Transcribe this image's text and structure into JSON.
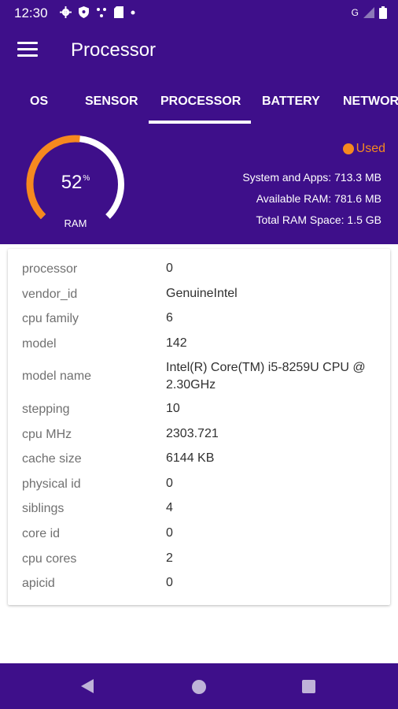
{
  "status_bar": {
    "time": "12:30",
    "network_label": "G",
    "icons": [
      "gear-icon",
      "shield-icon",
      "dots-icon",
      "sdcard-icon",
      "dot-icon",
      "signal-icon",
      "battery-icon"
    ]
  },
  "app_bar": {
    "title": "Processor"
  },
  "tabs": [
    {
      "label": "OS",
      "selected": false
    },
    {
      "label": "SENSOR",
      "selected": false
    },
    {
      "label": "PROCESSOR",
      "selected": true
    },
    {
      "label": "BATTERY",
      "selected": false
    },
    {
      "label": "NETWOR",
      "selected": false
    }
  ],
  "ram": {
    "percent": 52,
    "percent_value": "52",
    "percent_unit": "%",
    "label": "RAM",
    "legend": "Used",
    "rows": [
      {
        "label": "System and Apps:",
        "value": "713.3 MB"
      },
      {
        "label": "Available RAM:",
        "value": "781.6 MB"
      },
      {
        "label": "Total RAM Space:",
        "value": "1.5 GB"
      }
    ]
  },
  "cpu_info": [
    {
      "key": "processor",
      "value": "0"
    },
    {
      "key": "vendor_id",
      "value": "GenuineIntel"
    },
    {
      "key": "cpu family",
      "value": "6"
    },
    {
      "key": "model",
      "value": "142"
    },
    {
      "key": "model name",
      "value": "Intel(R) Core(TM) i5-8259U CPU @ 2.30GHz"
    },
    {
      "key": "stepping",
      "value": "10"
    },
    {
      "key": "cpu MHz",
      "value": "2303.721"
    },
    {
      "key": "cache size",
      "value": "6144 KB"
    },
    {
      "key": "physical id",
      "value": "0"
    },
    {
      "key": "siblings",
      "value": "4"
    },
    {
      "key": "core id",
      "value": "0"
    },
    {
      "key": "cpu cores",
      "value": "2"
    },
    {
      "key": "apicid",
      "value": "0"
    }
  ],
  "colors": {
    "primary": "#3e0f8a",
    "accent": "#f6891f",
    "white": "#ffffff"
  }
}
